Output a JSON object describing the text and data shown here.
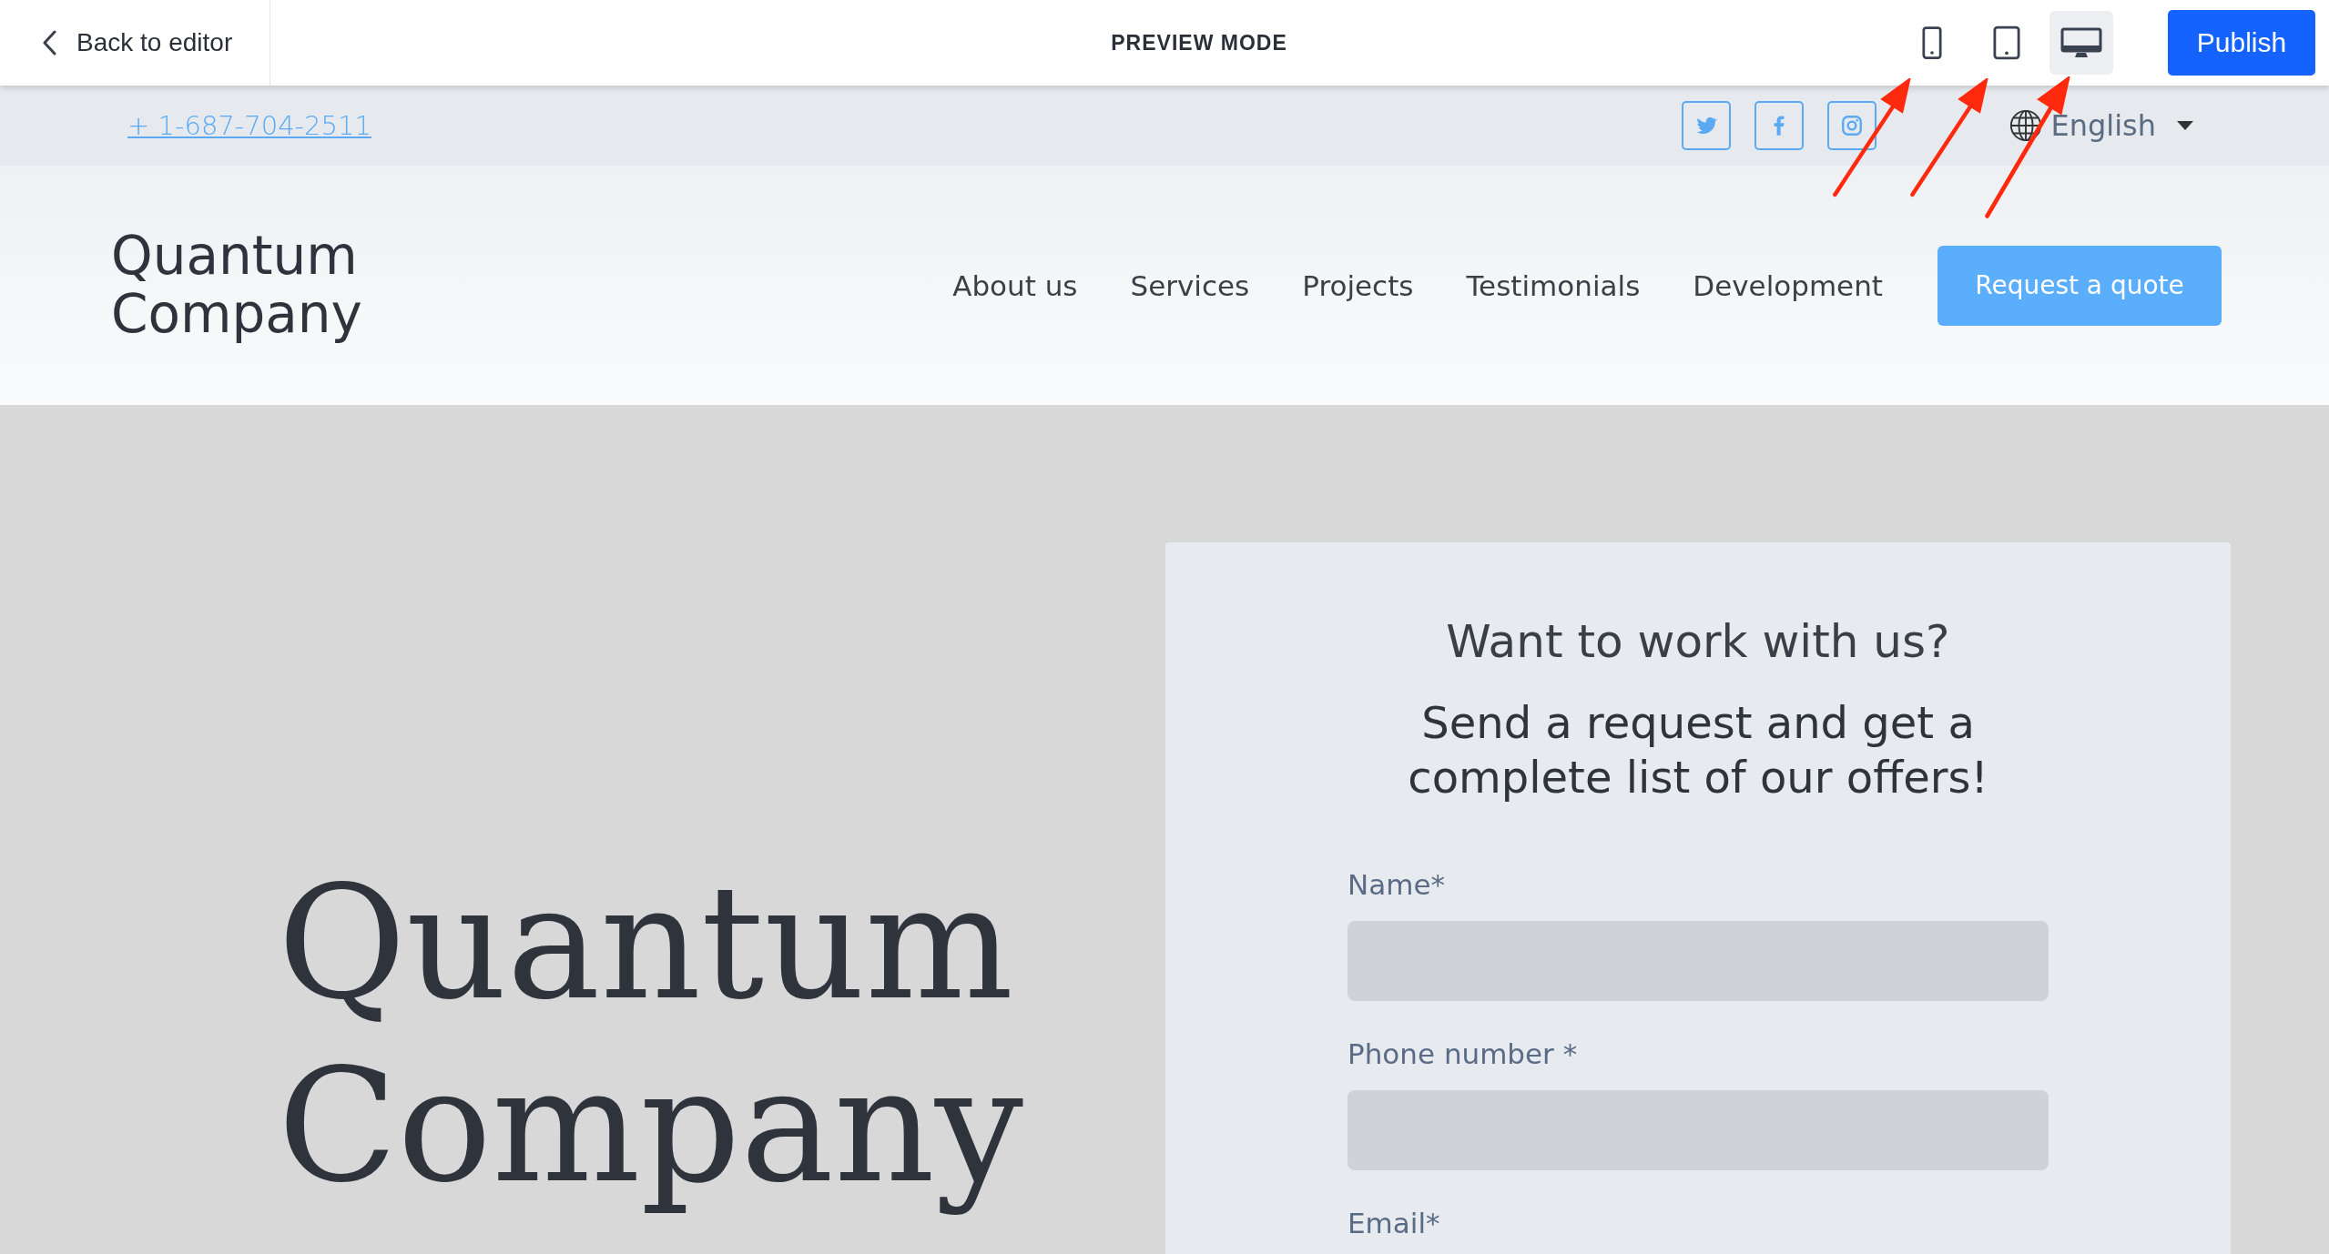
{
  "toolbar": {
    "back": {
      "label": "Back to editor"
    },
    "title": "PREVIEW MODE",
    "devices": [
      {
        "kind": "phone",
        "selected": false
      },
      {
        "kind": "tablet",
        "selected": false
      },
      {
        "kind": "desktop",
        "selected": true
      }
    ],
    "publish": "Publish"
  },
  "contact_bar": {
    "phone": "+ 1-687-704-2511",
    "social": [
      {
        "kind": "twitter"
      },
      {
        "kind": "facebook"
      },
      {
        "kind": "instagram"
      }
    ],
    "language": "English"
  },
  "header": {
    "logo": [
      "Quantum",
      "Company"
    ],
    "nav": [
      "About us",
      "Services",
      "Projects",
      "Testimonials",
      "Development"
    ],
    "cta": "Request a quote"
  },
  "hero": {
    "title": [
      "Quantum",
      "Company"
    ]
  },
  "form": {
    "title": "Want to work with us?",
    "subtitle": "Send a request and get a complete list of our offers!",
    "fields": [
      {
        "label": "Name*",
        "kind": "input"
      },
      {
        "label": "Phone number *",
        "kind": "input"
      },
      {
        "label": "Email*",
        "kind": "label"
      }
    ]
  }
}
